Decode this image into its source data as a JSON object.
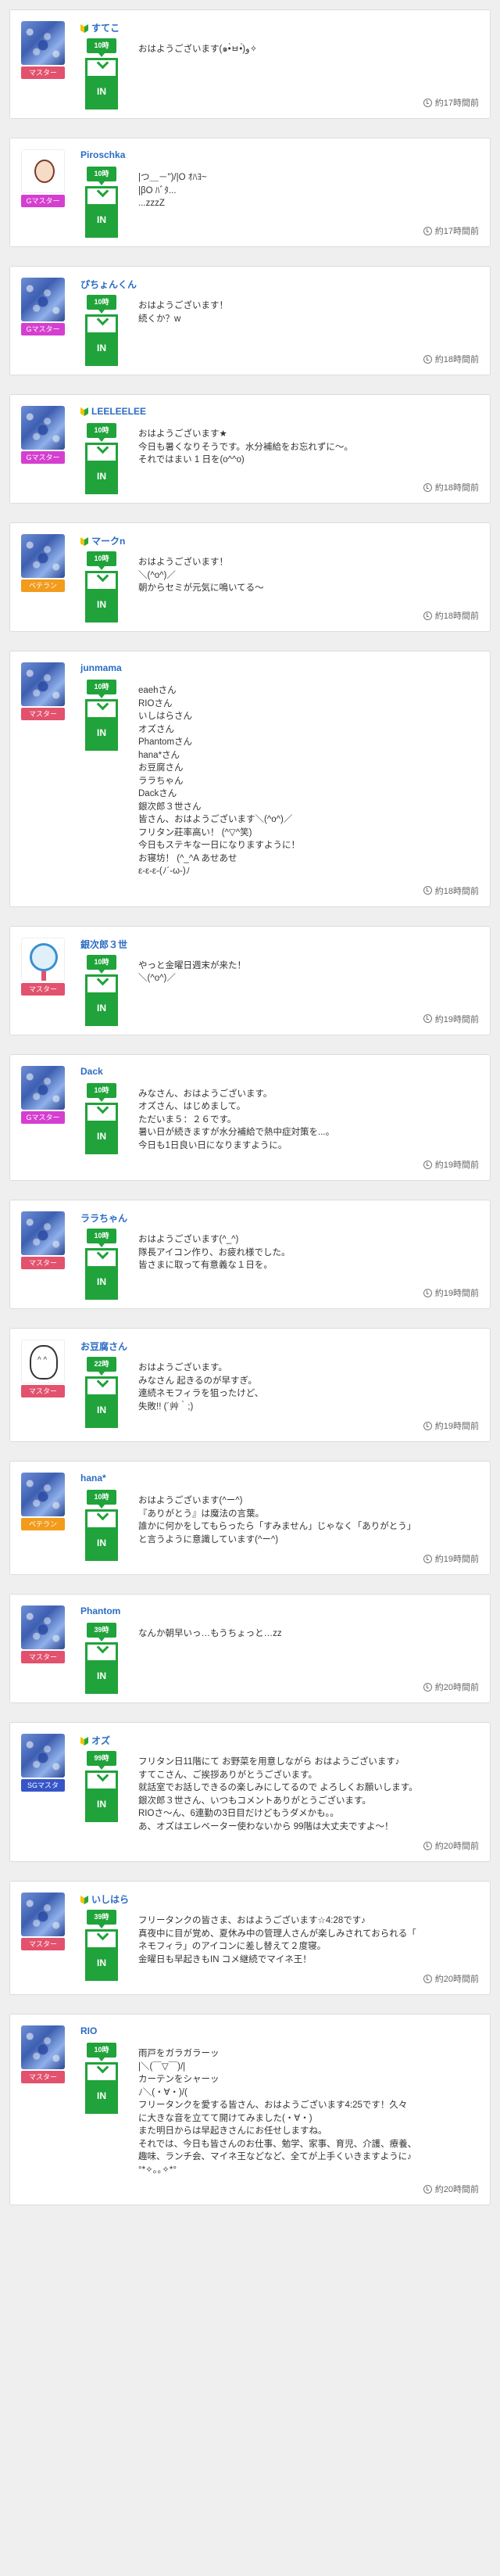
{
  "colors": {
    "green": "#1fa33a",
    "master": "#e2516d",
    "gmaster": "#d53fd0",
    "veteran": "#f39b1b",
    "sgmaster": "#3655c8",
    "link": "#2b6cc4"
  },
  "posts": [
    {
      "name": "すてこ",
      "leaf": true,
      "badge": "マスター",
      "badge_type": "master",
      "avatar": "flower",
      "time_tag": "10時",
      "in_label": "IN",
      "message": "おはようございます(๑•̀ㅂ•́)و✧",
      "ago": "約17時間前"
    },
    {
      "name": "Piroschka",
      "leaf": false,
      "badge": "Gマスター",
      "badge_type": "gmaster",
      "avatar": "face",
      "time_tag": "10時",
      "in_label": "IN",
      "message": "|つ＿－\")/|O ｵﾊﾖ~\n|βO ﾊﾞﾀ...\n...zzzZ",
      "ago": "約17時間前"
    },
    {
      "name": "ぴちょんくん",
      "leaf": false,
      "badge": "Gマスター",
      "badge_type": "gmaster",
      "avatar": "flower",
      "time_tag": "10時",
      "in_label": "IN",
      "message": "おはようございます！\n続くか？w",
      "ago": "約18時間前"
    },
    {
      "name": "LEELEELEE",
      "leaf": true,
      "badge": "Gマスター",
      "badge_type": "gmaster",
      "avatar": "flower",
      "time_tag": "10時",
      "in_label": "IN",
      "message": "おはようございます★\n今日も暑くなりそうです。水分補給をお忘れずに〜。\nそれではまい 1 日を(o^^o)",
      "ago": "約18時間前"
    },
    {
      "name": "マークn",
      "leaf": true,
      "badge": "ベテラン",
      "badge_type": "veteran",
      "avatar": "flower",
      "time_tag": "10時",
      "in_label": "IN",
      "message": "おはようございます！\n＼(^o^)／\n朝からセミが元気に鳴いてる〜",
      "ago": "約18時間前"
    },
    {
      "name": "junmama",
      "leaf": false,
      "badge": "マスター",
      "badge_type": "master",
      "avatar": "flower",
      "time_tag": "10時",
      "in_label": "IN",
      "message": "eaehさん\nRIOさん\nいしはらさん\nオズさん\nPhantomさん\nhana*さん\nお豆腐さん\nララちゃん\nDackさん\n銀次郎３世さん\n皆さん、おはようございます＼(^o^)／\nフリタン莊率高い！ (^▽^笑)\n今日もステキな一日になりますように！\nお寝坊！ (^_^A あせあせ\nε-ε-ε-(ﾉ´-ω-)ﾉ",
      "ago": "約18時間前"
    },
    {
      "name": "銀次郎３世",
      "leaf": false,
      "badge": "マスター",
      "badge_type": "master",
      "avatar": "fan",
      "time_tag": "10時",
      "in_label": "IN",
      "message": "やっと金曜日週末が来た！\n＼(^o^)／",
      "ago": "約19時間前"
    },
    {
      "name": "Dack",
      "leaf": false,
      "badge": "Gマスター",
      "badge_type": "gmaster",
      "avatar": "flower",
      "time_tag": "10時",
      "in_label": "IN",
      "message": "みなさん、おはようございます。\nオズさん、はじめまして。\nただいま５：２６です。\n暑い日が続きますが水分補給で熱中症対策を...。\n今日も1日良い日になりますように。",
      "ago": "約19時間前"
    },
    {
      "name": "ララちゃん",
      "leaf": false,
      "badge": "マスター",
      "badge_type": "master",
      "avatar": "flower",
      "time_tag": "10時",
      "in_label": "IN",
      "message": "おはようございます(^_^)\n隊長アイコン作り、お疲れ様でした。\n皆さまに取って有意義な１日を。",
      "ago": "約19時間前"
    },
    {
      "name": "お豆腐さん",
      "leaf": false,
      "badge": "マスター",
      "badge_type": "master",
      "avatar": "doodle",
      "time_tag": "22時",
      "in_label": "IN",
      "message": "おはようございます。\nみなさん 起きるのが早すぎ。\n連続ネモフィラを狙ったけど、\n失敗!! (´艸｀;)",
      "ago": "約19時間前"
    },
    {
      "name": "hana*",
      "leaf": false,
      "badge": "ベテラン",
      "badge_type": "veteran",
      "avatar": "flower",
      "time_tag": "10時",
      "in_label": "IN",
      "message": "おはようございます(^ー^)\n『ありがとう』は魔法の言葉。\n誰かに何かをしてもらったら「すみません」じゃなく「ありがとう」\nと言うように意識しています(^ー^)",
      "ago": "約19時間前"
    },
    {
      "name": "Phantom",
      "leaf": false,
      "badge": "マスター",
      "badge_type": "master",
      "avatar": "flower",
      "time_tag": "39時",
      "in_label": "IN",
      "message": "なんか朝早いっ…もうちょっと…zz",
      "ago": "約20時間前"
    },
    {
      "name": "オズ",
      "leaf": true,
      "badge": "SGマスタ",
      "badge_type": "sgmaster",
      "avatar": "flower",
      "time_tag": "99時",
      "in_label": "IN",
      "message": "フリタン日11階にて お野菜を用意しながら おはようございます♪\nすてこさん、ご挨拶ありがとうございます。\n就話室でお話しできるの楽しみにしてるので よろしくお願いします。\n銀次郎３世さん、いつもコメントありがとうございます。\nRIOさ〜ん、6連勤の3日目だけどもうダメかも。。\nあ、オズはエレベーター使わないから 99階は大丈夫ですよ〜！",
      "ago": "約20時間前"
    },
    {
      "name": "いしはら",
      "leaf": true,
      "badge": "マスター",
      "badge_type": "master",
      "avatar": "flower",
      "time_tag": "39時",
      "in_label": "IN",
      "message": "フリータンクの皆さま、おはようございます☆4:28です♪\n真夜中に目が覚め、夏休み中の管理人さんが楽しみされておられる「\nネモフィラ」のアイコンに差し替えて２度寝。\n金曜日も早起きもIN コメ継続でマイネ王！",
      "ago": "約20時間前"
    },
    {
      "name": "RIO",
      "leaf": false,
      "badge": "マスター",
      "badge_type": "master",
      "avatar": "flower",
      "time_tag": "10時",
      "in_label": "IN",
      "message": "雨戸をガラガラーッ\n|＼(￣▽￣)/|\nカーテンをシャーッ\nﾉ＼(・∀・)/(\nフリータンクを愛する皆さん、おはようございます4:25です！久々\nに大きな音を立てて開けてみました(・∀・)\nまた明日からは早起きさんにお任せしますね。\nそれでは、今日も皆さんのお仕事、勉学、家事、育児、介護、療養、\n趣味、ランチ会、マイネ王などなど、全てが上手くいきますように♪\n°*✧｡｡✧*°",
      "ago": "約20時間前"
    }
  ]
}
